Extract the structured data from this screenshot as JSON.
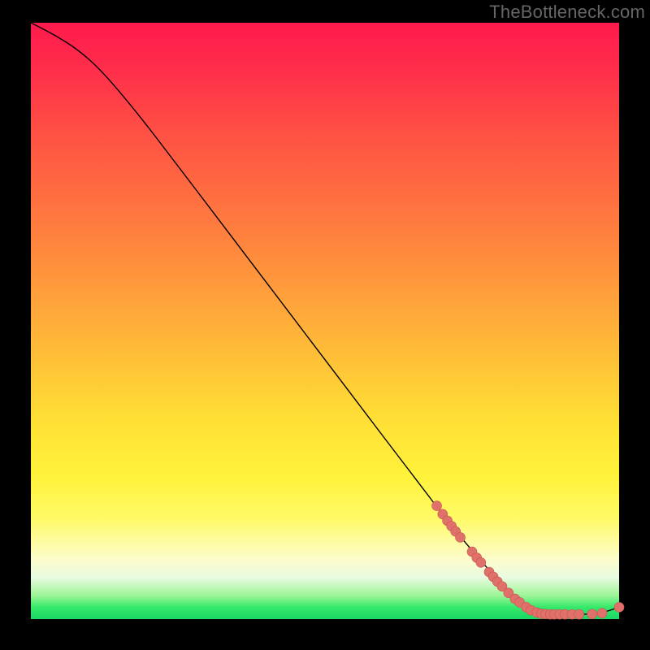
{
  "watermark": "TheBottleneck.com",
  "colors": {
    "curve_stroke": "#000000",
    "marker_fill": "#e0706a",
    "marker_stroke": "#c9554f",
    "gradient_top": "#ff1a4d",
    "gradient_bottom": "#19d765",
    "frame": "#000000"
  },
  "chart_data": {
    "type": "line",
    "title": "",
    "xlabel": "",
    "ylabel": "",
    "xlim": [
      0,
      100
    ],
    "ylim": [
      0,
      100
    ],
    "curve": [
      {
        "x": 0,
        "y": 100
      },
      {
        "x": 4,
        "y": 98
      },
      {
        "x": 8,
        "y": 95.5
      },
      {
        "x": 12,
        "y": 92
      },
      {
        "x": 18,
        "y": 85
      },
      {
        "x": 25,
        "y": 76
      },
      {
        "x": 35,
        "y": 63
      },
      {
        "x": 45,
        "y": 50
      },
      {
        "x": 55,
        "y": 37
      },
      {
        "x": 65,
        "y": 24
      },
      {
        "x": 72,
        "y": 15
      },
      {
        "x": 78,
        "y": 8
      },
      {
        "x": 83,
        "y": 3
      },
      {
        "x": 86,
        "y": 1.2
      },
      {
        "x": 90,
        "y": 0.8
      },
      {
        "x": 94,
        "y": 0.8
      },
      {
        "x": 97,
        "y": 1.0
      },
      {
        "x": 100,
        "y": 2.0
      }
    ],
    "markers": [
      {
        "x": 69,
        "y": 19
      },
      {
        "x": 70,
        "y": 17.6
      },
      {
        "x": 70.8,
        "y": 16.5
      },
      {
        "x": 71.5,
        "y": 15.6
      },
      {
        "x": 72.2,
        "y": 14.7
      },
      {
        "x": 73,
        "y": 13.7
      },
      {
        "x": 75,
        "y": 11.3
      },
      {
        "x": 75.8,
        "y": 10.3
      },
      {
        "x": 76.5,
        "y": 9.5
      },
      {
        "x": 77.9,
        "y": 7.9
      },
      {
        "x": 78.6,
        "y": 7.1
      },
      {
        "x": 79.3,
        "y": 6.3
      },
      {
        "x": 80.1,
        "y": 5.5
      },
      {
        "x": 81.2,
        "y": 4.4
      },
      {
        "x": 82.3,
        "y": 3.4
      },
      {
        "x": 83.1,
        "y": 2.8
      },
      {
        "x": 84.2,
        "y": 2.0
      },
      {
        "x": 85.0,
        "y": 1.5
      },
      {
        "x": 86.0,
        "y": 1.1
      },
      {
        "x": 86.8,
        "y": 0.9
      },
      {
        "x": 87.5,
        "y": 0.85
      },
      {
        "x": 88.3,
        "y": 0.8
      },
      {
        "x": 89.0,
        "y": 0.8
      },
      {
        "x": 89.9,
        "y": 0.8
      },
      {
        "x": 90.8,
        "y": 0.8
      },
      {
        "x": 92.0,
        "y": 0.8
      },
      {
        "x": 93.2,
        "y": 0.8
      },
      {
        "x": 95.4,
        "y": 0.85
      },
      {
        "x": 97.1,
        "y": 1.0
      },
      {
        "x": 100.0,
        "y": 2.0
      }
    ]
  }
}
